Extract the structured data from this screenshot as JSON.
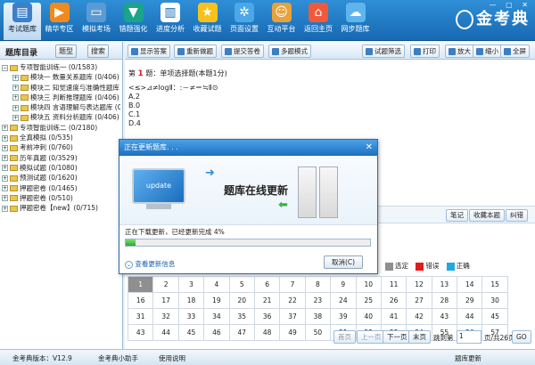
{
  "toolbar": {
    "tools": [
      {
        "label": "考试题库",
        "icon": "book-icon"
      },
      {
        "label": "精华专区",
        "icon": "play-icon"
      },
      {
        "label": "模拟考场",
        "icon": "monitor-icon"
      },
      {
        "label": "错题强化",
        "icon": "bookmark-icon"
      },
      {
        "label": "进度分析",
        "icon": "chart-icon"
      },
      {
        "label": "收藏试题",
        "icon": "star-icon"
      },
      {
        "label": "页面设置",
        "icon": "gear-icon"
      },
      {
        "label": "互动平台",
        "icon": "people-icon"
      },
      {
        "label": "返回主页",
        "icon": "home-icon"
      },
      {
        "label": "网步题库",
        "icon": "cloud-icon"
      }
    ],
    "logo": "金考典",
    "window_controls": "— ▢ ✕"
  },
  "sidebar": {
    "title": "题库目录",
    "btn_tree": "题型",
    "btn_search": "搜索",
    "tree": [
      {
        "label": "专项智能训练一 (0/1583)",
        "level": 0,
        "expand": "−"
      },
      {
        "label": "模块一 数量关系题库 (0/406)",
        "level": 1,
        "expand": "+"
      },
      {
        "label": "模块二 知觉速度与准确性题库 (0/",
        "level": 1,
        "expand": "+"
      },
      {
        "label": "模块三 判断推理题库 (0/406)",
        "level": 1,
        "expand": "+"
      },
      {
        "label": "模块四 言语理解与表达题库 (0/4",
        "level": 1,
        "expand": "+"
      },
      {
        "label": "模块五 资料分析题库 (0/406)",
        "level": 1,
        "expand": "+"
      },
      {
        "label": "专项智能训练二 (0/2180)",
        "level": 0,
        "expand": "+"
      },
      {
        "label": "全真模拟 (0/535)",
        "level": 0,
        "expand": "+"
      },
      {
        "label": "考前冲刺 (0/760)",
        "level": 0,
        "expand": "+"
      },
      {
        "label": "历年真题 (0/3529)",
        "level": 0,
        "expand": "+"
      },
      {
        "label": "模拟试题 (0/1080)",
        "level": 0,
        "expand": "+"
      },
      {
        "label": "预测试题 (0/1620)",
        "level": 0,
        "expand": "+"
      },
      {
        "label": "押题密卷 (0/1465)",
        "level": 0,
        "expand": "+"
      },
      {
        "label": "押题密卷 (0/510)",
        "level": 0,
        "expand": "+"
      },
      {
        "label": "押题密卷【new】(0/715)",
        "level": 0,
        "expand": "+"
      }
    ]
  },
  "content_toolbar": {
    "buttons": [
      "显示答案",
      "重新做题",
      "提交答卷",
      "多题模式"
    ],
    "right_buttons": [
      "试题筛选",
      "打印",
      "放大",
      "缩小",
      "全屏"
    ]
  },
  "question": {
    "prefix": "第",
    "number": "1",
    "suffix": "题：单项选择题(本题1分)",
    "stem": "<≤>⊿≠logⅡ：:－≠＝≒Ⅱ⊙",
    "options": [
      "A.2",
      "B.0",
      "C.1",
      "D.4"
    ]
  },
  "answer_bar": {
    "buttons": [
      "笔记",
      "收藏本题",
      "纠错"
    ]
  },
  "legend": {
    "items": [
      {
        "label": "选定",
        "color": "#8f8f8f"
      },
      {
        "label": "错误",
        "color": "#e21c1c"
      },
      {
        "label": "正确",
        "color": "#1fa9e0"
      }
    ]
  },
  "answer_card": {
    "rows": [
      [
        "1",
        "2",
        "3",
        "4",
        "5",
        "6",
        "7",
        "8",
        "9",
        "10",
        "11",
        "12",
        "13",
        "14",
        "15"
      ],
      [
        "16",
        "17",
        "18",
        "19",
        "20",
        "21",
        "22",
        "23",
        "24",
        "25",
        "26",
        "27",
        "28",
        "29",
        "30"
      ],
      [
        "31",
        "32",
        "33",
        "34",
        "35",
        "36",
        "37",
        "38",
        "39",
        "40",
        "41",
        "42",
        "43",
        "44",
        "45"
      ],
      [
        "43",
        "44",
        "45",
        "46",
        "47",
        "48",
        "49",
        "50",
        "51",
        "52",
        "53",
        "54",
        "55",
        "56",
        "57"
      ]
    ]
  },
  "pager": {
    "first": "首页",
    "prev": "上一页",
    "next": "下一页",
    "last": "末页",
    "goto_label": "跳到第",
    "page_value": "1",
    "page_suffix": "页/共26页",
    "go": "GO"
  },
  "status": {
    "version": "金考典版本：V12.9",
    "assistant": "金考典小助手",
    "help": "使用说明",
    "right": "题库更新"
  },
  "dialog": {
    "title": "正在更新题库. . .",
    "close": "✕",
    "screen_text": "update",
    "big_text": "题库在线更新",
    "progress_text": "正在下载更新，已经更新完成 4%",
    "progress": 0.04,
    "more": "查看更新信息",
    "cancel": "取消(C)"
  }
}
